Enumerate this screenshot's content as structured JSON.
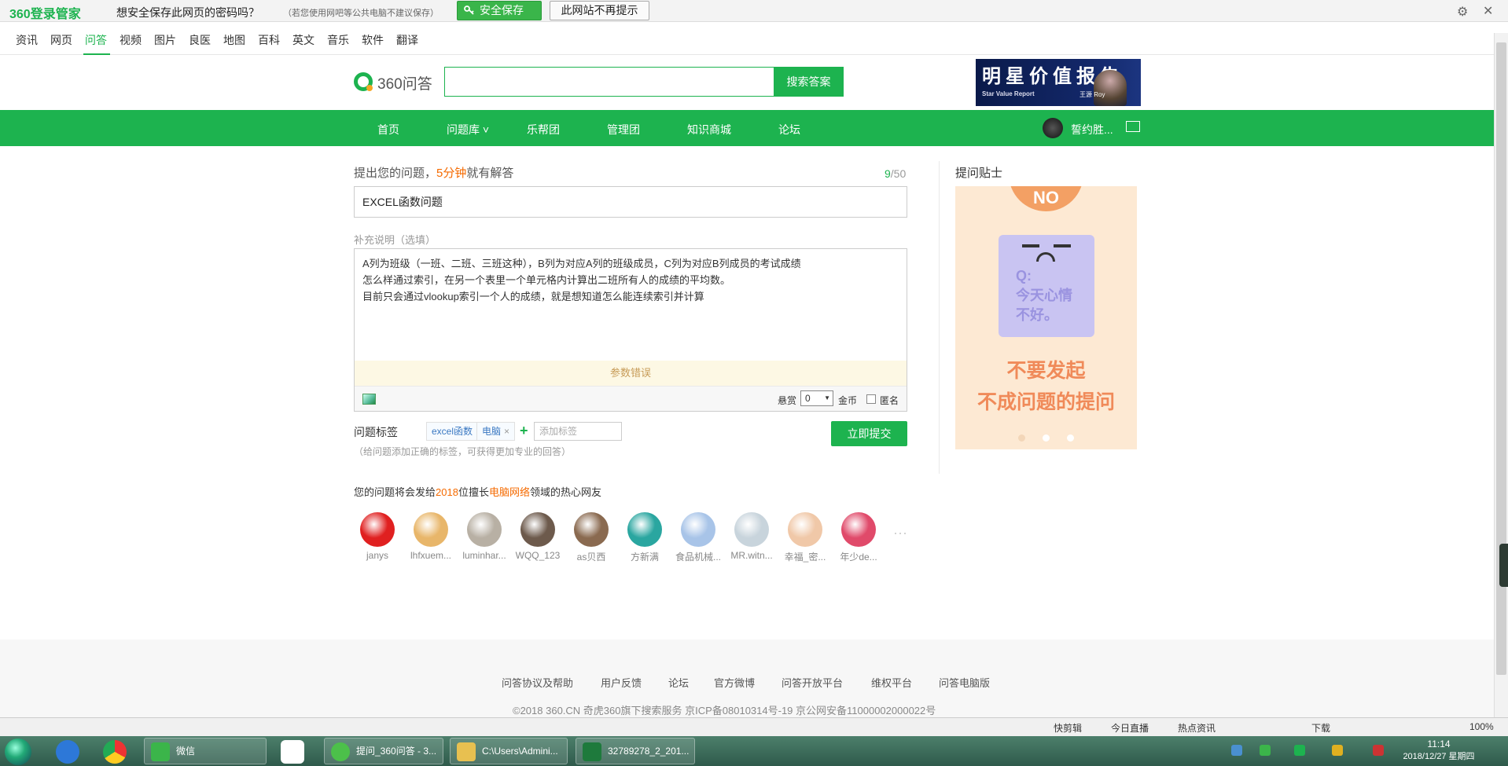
{
  "password_bar": {
    "logo": "360登录管家",
    "message": "想安全保存此网页的密码吗？",
    "note": "（若您使用网吧等公共电脑不建议保存）",
    "save_label": "安全保存",
    "dismiss_label": "此网站不再提示"
  },
  "nav_tabs": [
    "资讯",
    "网页",
    "问答",
    "视频",
    "图片",
    "良医",
    "地图",
    "百科",
    "英文",
    "音乐",
    "软件",
    "翻译"
  ],
  "brand": "360问答",
  "search": {
    "placeholder": "",
    "button": "搜索答案"
  },
  "banner": {
    "title": "明星价值报告",
    "subtitle": "Star Value Report",
    "name": "王源 Roy"
  },
  "green_nav": {
    "items": [
      "首页",
      "问题库 ˅",
      "乐帮团",
      "管理团",
      "知识商城",
      "论坛"
    ],
    "user": "誓约胜..."
  },
  "form": {
    "title_label_pre": "提出您的问题，",
    "title_label_hl": "5分钟",
    "title_label_post": "就有解答",
    "count_current": "9",
    "count_max": "/50",
    "title_value": "EXCEL函数问题",
    "desc_label": "补充说明（选填）",
    "desc_value": "A列为班级（一班、二班、三班这种），B列为对应A列的班级成员，C列为对应B列成员的考试成绩\n怎么样通过索引，在另一个表里一个单元格内计算出二班所有人的成绩的平均数。\n目前只会通过vlookup索引一个人的成绩，就是想知道怎么能连续索引并计算",
    "error": "参数错误",
    "reward_label": "悬赏",
    "reward_value": "0",
    "coin_label": "金币",
    "anon_label": "匿名",
    "tags_label": "问题标签",
    "tags": [
      "excel函数",
      "电脑"
    ],
    "tag_remove": "×",
    "tag_add": "+",
    "tag_placeholder": "添加标签",
    "tags_hint": "（给问题添加正确的标签，可获得更加专业的回答）",
    "submit": "立即提交"
  },
  "send": {
    "pre": "您的问题将会发给",
    "count": "2018",
    "mid": "位擅长",
    "field": "电脑网络",
    "post": "领域的热心网友"
  },
  "experts": [
    {
      "name": "janys",
      "color": "#e02020"
    },
    {
      "name": "lhfxuem...",
      "color": "#e8b66a"
    },
    {
      "name": "luminhar...",
      "color": "#b8b0a4"
    },
    {
      "name": "WQQ_123",
      "color": "#6d5a4c"
    },
    {
      "name": "as贝西",
      "color": "#8a6a50"
    },
    {
      "name": "方新满",
      "color": "#2aa6a0"
    },
    {
      "name": "食品机械...",
      "color": "#a8c4e8"
    },
    {
      "name": "MR.witn...",
      "color": "#c8d4dc"
    },
    {
      "name": "幸福_密...",
      "color": "#f0c8a8"
    },
    {
      "name": "年少de...",
      "color": "#e04a6a"
    }
  ],
  "more": "···",
  "tips": {
    "title": "提问贴士",
    "no": "NO",
    "face_text": "Q:\n今天心情\n不好。",
    "line1": "不要发起",
    "line2": "不成问题的提问"
  },
  "footer": {
    "links": [
      "问答协议及帮助",
      "用户反馈",
      "论坛",
      "官方微博",
      "问答开放平台",
      "维权平台",
      "问答电脑版"
    ],
    "copyright": "©2018 360.CN 奇虎360旗下搜索服务   京ICP备08010314号-19 京公网安备11000002000022号"
  },
  "status_bar": [
    "快剪辑",
    "今日直播",
    "热点资讯",
    "下载",
    "100%"
  ],
  "taskbar": {
    "tasks": [
      "微信",
      "提问_360问答 - 3...",
      "C:\\Users\\Admini...",
      "32789278_2_201..."
    ],
    "time": "11:14",
    "date": "2018/12/27 星期四"
  },
  "colors": {
    "brand_green": "#1db34f",
    "highlight_orange": "#f56a00"
  }
}
